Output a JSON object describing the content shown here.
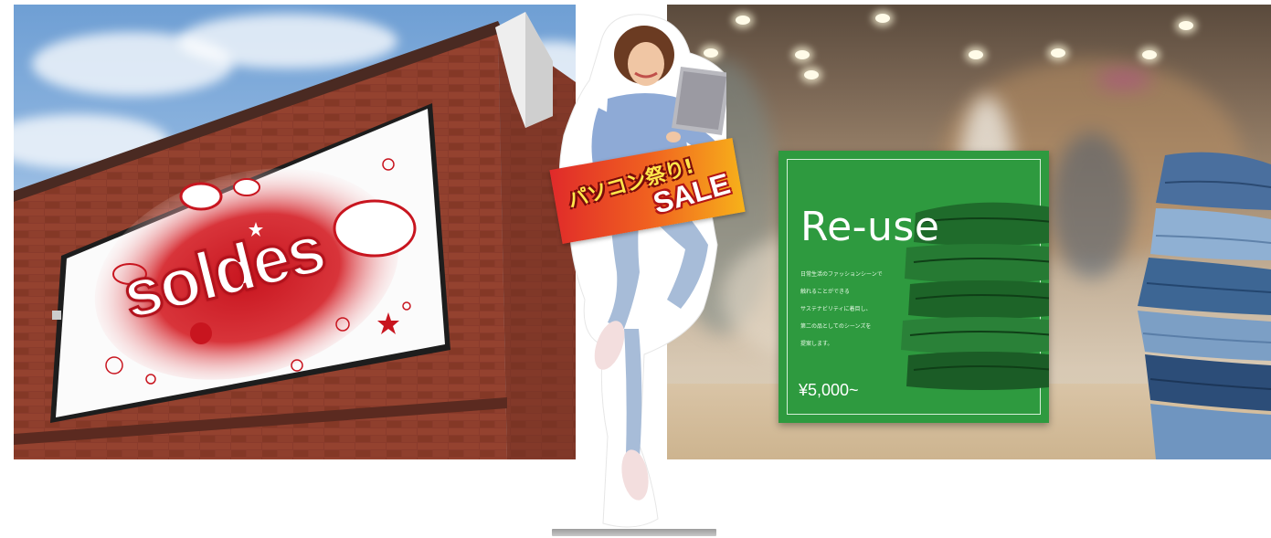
{
  "billboard": {
    "text": "soldes"
  },
  "standee": {
    "banner_text_jp": "パソコン祭り!",
    "banner_text_sale": "SALE"
  },
  "reuse_poster": {
    "title": "Re-use",
    "body_lines": [
      "日常生活のファッションシーンで",
      "触れることができる",
      "サステナビリティに着目し、",
      "第二の品としてのシーンズを",
      "提案します。"
    ],
    "price": "¥5,000~"
  },
  "colors": {
    "poster_green": "#2e9a3f",
    "billboard_red": "#c8151f",
    "brick": "#8a3b2c"
  }
}
